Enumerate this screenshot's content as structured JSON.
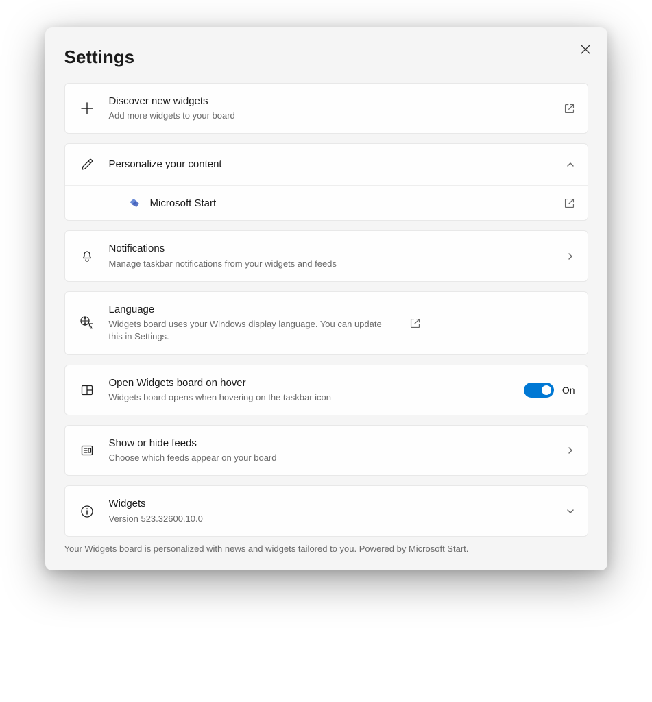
{
  "title": "Settings",
  "discover": {
    "title": "Discover new widgets",
    "subtitle": "Add more widgets to your board"
  },
  "personalize": {
    "title": "Personalize your content",
    "msstart_label": "Microsoft Start"
  },
  "notifications": {
    "title": "Notifications",
    "subtitle": "Manage taskbar notifications from your widgets and feeds"
  },
  "language": {
    "title": "Language",
    "subtitle": "Widgets board uses your Windows display language. You can update this in Settings."
  },
  "hover": {
    "title": "Open Widgets board on hover",
    "subtitle": "Widgets board opens when hovering on the taskbar icon",
    "state": "On"
  },
  "feeds": {
    "title": "Show or hide feeds",
    "subtitle": "Choose which feeds appear on your board"
  },
  "widgets": {
    "title": "Widgets",
    "version": "Version 523.32600.10.0"
  },
  "footnote": "Your Widgets board is personalized with news and widgets tailored to you. Powered by Microsoft Start."
}
